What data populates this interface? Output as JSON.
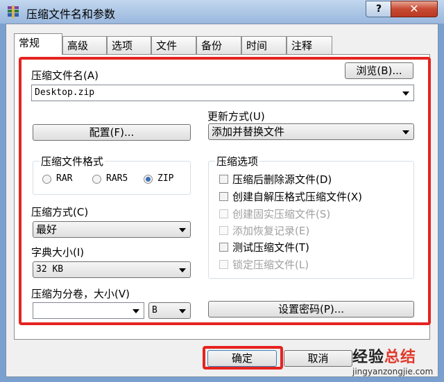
{
  "window": {
    "title": "压缩文件名和参数",
    "help_label": "?",
    "close_label": "✕"
  },
  "tabs": [
    "常规",
    "高级",
    "选项",
    "文件",
    "备份",
    "时间",
    "注释"
  ],
  "general": {
    "archive_name_label": "压缩文件名(A)",
    "browse_label": "浏览(B)...",
    "archive_name_value": "Desktop.zip",
    "profiles_label": "配置(F)...",
    "update_mode_label": "更新方式(U)",
    "update_mode_value": "添加并替换文件",
    "format_group_label": "压缩文件格式",
    "formats": [
      "RAR",
      "RAR5",
      "ZIP"
    ],
    "selected_format": "ZIP",
    "method_label": "压缩方式(C)",
    "method_value": "最好",
    "dict_label": "字典大小(I)",
    "dict_value": "32 KB",
    "split_label": "压缩为分卷，大小(V)",
    "split_value": "",
    "split_unit": "B",
    "options_group_label": "压缩选项",
    "options": [
      {
        "label": "压缩后删除源文件(D)",
        "enabled": true,
        "checked": false
      },
      {
        "label": "创建自解压格式压缩文件(X)",
        "enabled": true,
        "checked": false
      },
      {
        "label": "创建固实压缩文件(S)",
        "enabled": false,
        "checked": false
      },
      {
        "label": "添加恢复记录(E)",
        "enabled": false,
        "checked": false
      },
      {
        "label": "测试压缩文件(T)",
        "enabled": true,
        "checked": false
      },
      {
        "label": "锁定压缩文件(L)",
        "enabled": false,
        "checked": false
      }
    ],
    "set_password_label": "设置密码(P)..."
  },
  "footer": {
    "ok_label": "确定",
    "cancel_label": "取消"
  },
  "watermark": {
    "text_black": "经验",
    "text_red": "总结",
    "url": "jingyanzongjie.com"
  },
  "colors": {
    "highlight_red": "#e5231f",
    "radio_selected": "#3a6fb3"
  }
}
